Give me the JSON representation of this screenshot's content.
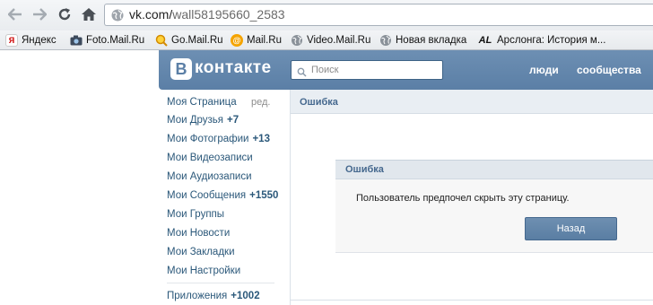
{
  "browser": {
    "url_host": "vk.com/",
    "url_path": "wall58195660_2583",
    "bookmarks": [
      {
        "label": "Яндекс",
        "icon": "yandex-icon",
        "color": "#cc0000"
      },
      {
        "label": "Foto.Mail.Ru",
        "icon": "camera-icon",
        "color": "#3b5998"
      },
      {
        "label": "Go.Mail.Ru",
        "icon": "magnifier-icon",
        "color": "#f5a400"
      },
      {
        "label": "Mail.Ru",
        "icon": "mailru-icon",
        "color": "#168de2"
      },
      {
        "label": "Video.Mail.Ru",
        "icon": "globe-icon",
        "color": "#777777"
      },
      {
        "label": "Новая вкладка",
        "icon": "globe-icon",
        "color": "#777777"
      },
      {
        "label": "Арслонга: История м...",
        "icon": "al-icon",
        "color": "#111111"
      }
    ]
  },
  "vk": {
    "logo_letter": "В",
    "logo_text": "контакте",
    "search_placeholder": "Поиск",
    "nav": [
      "люди",
      "сообщества"
    ],
    "edit_label": "ред.",
    "menu": [
      {
        "label": "Моя Страница",
        "count": ""
      },
      {
        "label": "Мои Друзья",
        "count": "+7"
      },
      {
        "label": "Мои Фотографии",
        "count": "+13"
      },
      {
        "label": "Мои Видеозаписи",
        "count": ""
      },
      {
        "label": "Мои Аудиозаписи",
        "count": ""
      },
      {
        "label": "Мои Сообщения",
        "count": "+1550"
      },
      {
        "label": "Мои Группы",
        "count": ""
      },
      {
        "label": "Мои Новости",
        "count": ""
      },
      {
        "label": "Мои Закладки",
        "count": ""
      },
      {
        "label": "Мои Настройки",
        "count": ""
      },
      {
        "label": "Приложения",
        "count": "+1002"
      }
    ],
    "page_title": "Ошибка",
    "dialog": {
      "title": "Ошибка",
      "message": "Пользователь предпочел скрыть эту страницу.",
      "back_button": "Назад"
    },
    "colors": {
      "brand": "#5b7fa6",
      "link": "#2b587a",
      "header_text": "#45688e"
    }
  }
}
